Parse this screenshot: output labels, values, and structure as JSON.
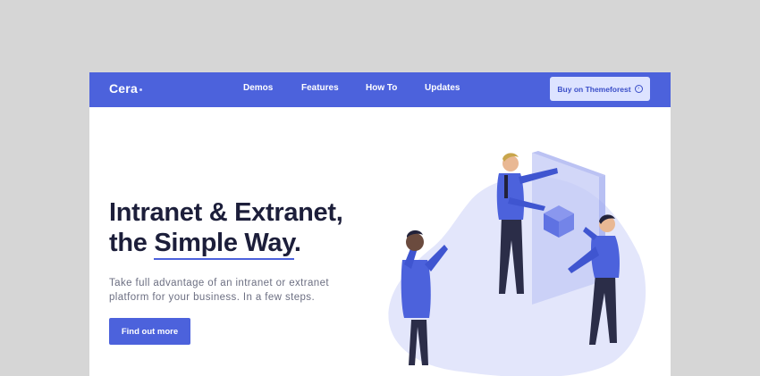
{
  "brand": {
    "name": "Cera"
  },
  "nav": {
    "links": [
      {
        "label": "Demos"
      },
      {
        "label": "Features"
      },
      {
        "label": "How To"
      },
      {
        "label": "Updates"
      }
    ],
    "cta_label": "Buy on Themeforest",
    "cta_icon": "arrow-circle-icon"
  },
  "hero": {
    "title_line1": "Intranet & Extranet,",
    "title_line2_prefix": "the ",
    "title_line2_highlight": "Simple Way",
    "title_line2_suffix": ".",
    "description": "Take full advantage of an intranet or extranet platform for your business. In a few steps.",
    "button_label": "Find out more"
  },
  "colors": {
    "accent": "#4c62dc",
    "page_bg": "#d6d6d6",
    "heading": "#1c1e3a",
    "body_text": "#6c6f82",
    "illustration_blob": "#e3e6fb"
  }
}
